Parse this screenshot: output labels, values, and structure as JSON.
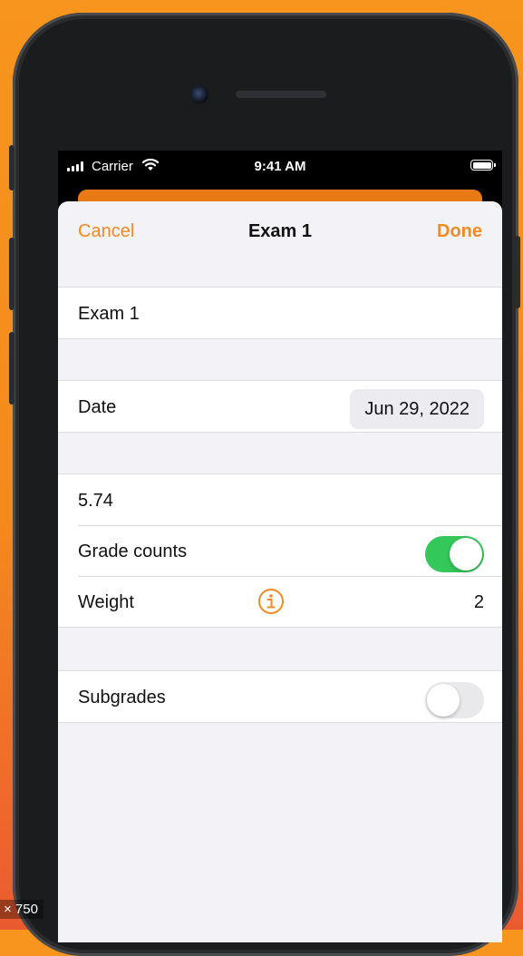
{
  "status_bar": {
    "carrier": "Carrier",
    "time": "9:41 AM"
  },
  "nav": {
    "cancel_label": "Cancel",
    "title": "Exam 1",
    "done_label": "Done"
  },
  "form": {
    "name_value": "Exam 1",
    "date_label": "Date",
    "date_value": "Jun 29, 2022",
    "grade_value": "5.74",
    "grade_counts_label": "Grade counts",
    "grade_counts_on": true,
    "weight_label": "Weight",
    "weight_value": "2",
    "subgrades_label": "Subgrades",
    "subgrades_on": false
  },
  "overlay_tag": "× 750",
  "colors": {
    "accent": "#f08a24",
    "toggle_on": "#34c759",
    "background": "#f7951e"
  }
}
